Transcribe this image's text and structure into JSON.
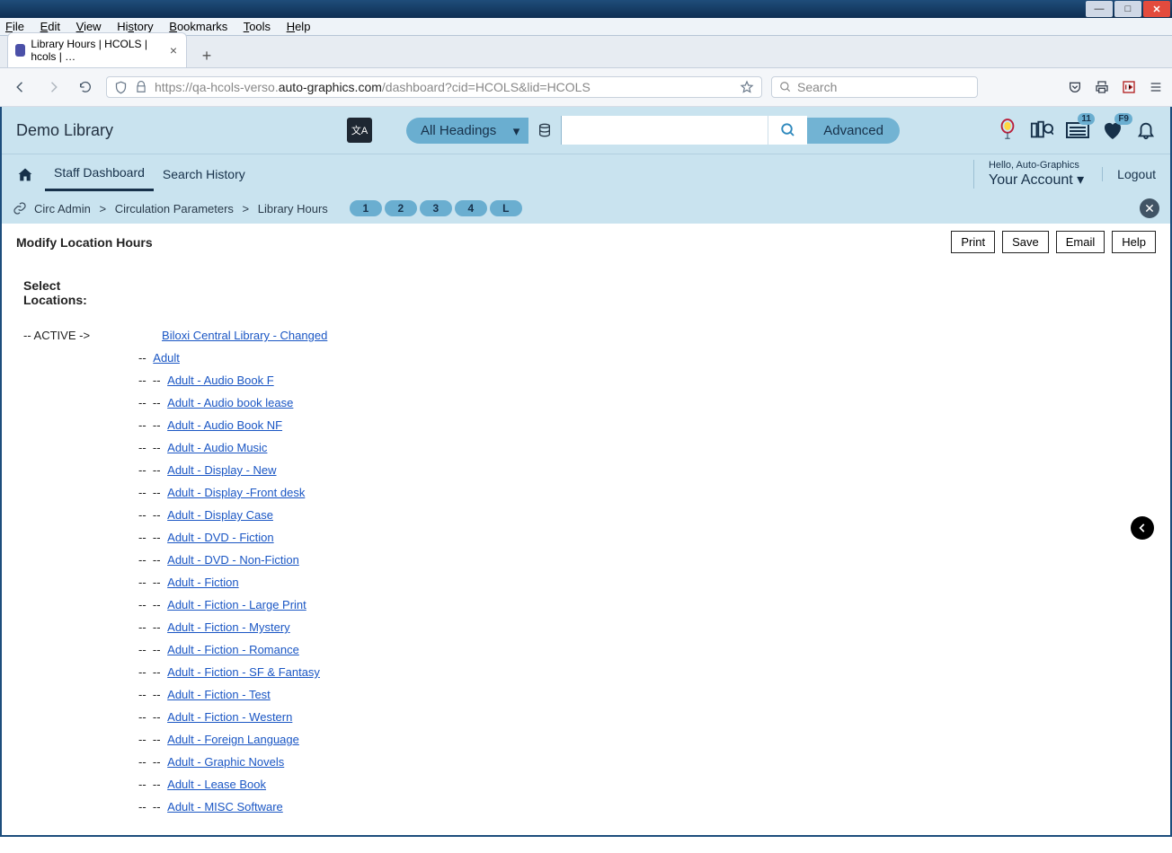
{
  "window": {
    "min": "—",
    "max": "□",
    "close": "✕"
  },
  "menubar": {
    "items": [
      "File",
      "Edit",
      "View",
      "History",
      "Bookmarks",
      "Tools",
      "Help"
    ]
  },
  "tab": {
    "title": "Library Hours | HCOLS | hcols | …"
  },
  "urlbar": {
    "prefix": "https://qa-hcols-verso.",
    "emph": "auto-graphics.com",
    "suffix": "/dashboard?cid=HCOLS&lid=HCOLS"
  },
  "browser_search": {
    "placeholder": "Search"
  },
  "app": {
    "title": "Demo Library",
    "headings": "All Headings",
    "advanced": "Advanced",
    "badges": {
      "list": "11",
      "fav": "F9"
    },
    "hello": "Hello, Auto-Graphics",
    "your_account": "Your Account",
    "logout": "Logout",
    "nav": {
      "staff": "Staff Dashboard",
      "history": "Search History"
    }
  },
  "breadcrumb": {
    "items": [
      "Circ Admin",
      "Circulation Parameters",
      "Library Hours"
    ],
    "pages": [
      "1",
      "2",
      "3",
      "4",
      "L"
    ]
  },
  "toolbar": {
    "title": "Modify Location Hours",
    "buttons": {
      "print": "Print",
      "save": "Save",
      "email": "Email",
      "help": "Help"
    }
  },
  "content": {
    "select_label_l1": "Select",
    "select_label_l2": "Locations:",
    "active_prefix": "-- ACTIVE ->",
    "root_link": "Biloxi Central Library - Changed",
    "level2_prefix": "-- ",
    "level3_prefix": "--  -- ",
    "adult": "Adult",
    "items": [
      "Adult - Audio Book F",
      "Adult - Audio book lease",
      "Adult - Audio Book NF",
      "Adult - Audio Music",
      "Adult - Display - New",
      "Adult - Display -Front desk",
      "Adult - Display Case",
      "Adult - DVD - Fiction",
      "Adult - DVD - Non-Fiction",
      "Adult - Fiction",
      "Adult - Fiction - Large Print",
      "Adult - Fiction - Mystery",
      "Adult - Fiction - Romance",
      "Adult - Fiction - SF & Fantasy",
      "Adult - Fiction - Test",
      "Adult - Fiction - Western",
      "Adult - Foreign Language",
      "Adult - Graphic Novels",
      "Adult - Lease Book",
      "Adult - MISC Software"
    ]
  }
}
